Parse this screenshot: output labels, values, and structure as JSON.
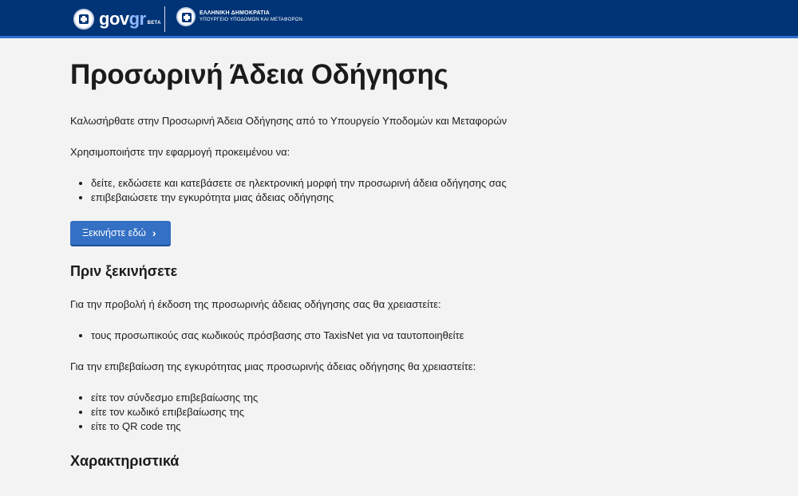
{
  "header": {
    "logo_gov": "gov",
    "logo_gr": "gr",
    "beta": "BETA",
    "ministry_line1": "ΕΛΛΗΝΙΚΗ ΔΗΜΟΚΡΑΤΙΑ",
    "ministry_line2": "ΥΠΟΥΡΓΕΙΟ ΥΠΟΔΟΜΩΝ ΚΑΙ ΜΕΤΑΦΟΡΩΝ"
  },
  "main": {
    "title": "Προσωρινή Άδεια Οδήγησης",
    "welcome": "Καλωσήρθατε στην Προσωρινή Άδεια Οδήγησης από το Υπουργείο Υποδομών και Μεταφορών",
    "use_intro": "Χρησιμοποιήστε την εφαρμογή προκειμένου να:",
    "use_items": [
      "δείτε, εκδώσετε και κατεβάσετε σε ηλεκτρονική μορφή την προσωρινή άδεια οδήγησης σας",
      "επιβεβαιώσετε την εγκυρότητα μιας άδειας οδήγησης"
    ],
    "start_button": "Ξεκινήστε εδώ",
    "before_heading": "Πριν ξεκινήσετε",
    "need_view": "Για την προβολή ή έκδοση της προσωρινής άδειας οδήγησης σας θα χρειαστείτε:",
    "need_view_items": [
      "τους προσωπικούς σας κωδικούς πρόσβασης στο TaxisNet για να ταυτοποιηθείτε"
    ],
    "need_verify": "Για την επιβεβαίωση της εγκυρότητας μιας προσωρινής άδειας οδήγησης θα χρειαστείτε:",
    "need_verify_items": [
      "είτε τον σύνδεσμο επιβεβαίωσης της",
      "είτε τον κωδικό επιβεβαίωσης της",
      "είτε το QR code της"
    ],
    "features_heading": "Χαρακτηριστικά"
  },
  "colors": {
    "header_bg": "#003476",
    "header_accent": "#2e6fd0",
    "button_bg": "#3470c4",
    "page_bg": "#f3f3f3"
  },
  "icons": {
    "logo": "greek-state-emblem-icon",
    "button": "chevron-right-icon"
  }
}
